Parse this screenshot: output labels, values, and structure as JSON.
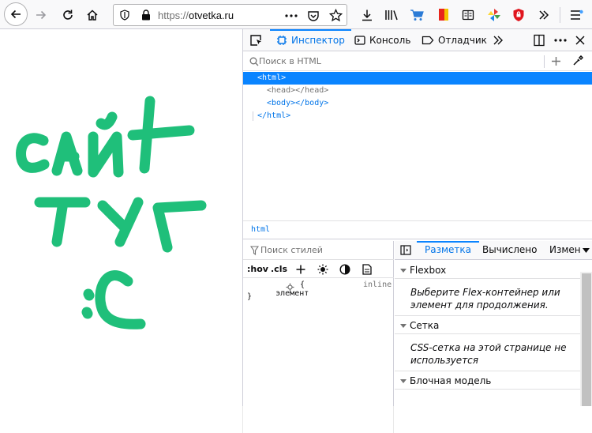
{
  "toolbar": {
    "url_protocol": "https://",
    "url_host": "otvetka.ru"
  },
  "devtools": {
    "tabs": [
      {
        "label": "Инспектор"
      },
      {
        "label": "Консоль"
      },
      {
        "label": "Отладчик"
      }
    ],
    "search_placeholder": "Поиск в HTML",
    "markup": [
      "<html>",
      "<head></head>",
      "<body></body>",
      "</html>"
    ],
    "breadcrumb": "html",
    "rules": {
      "filter_placeholder": "Поиск стилей",
      "hov": ":hov",
      "cls": ".cls",
      "element_label": "элемент",
      "brace_open": "{",
      "brace_close": "}",
      "inline_label": "inline"
    },
    "layout": {
      "tabs": [
        "Разметка",
        "Вычислено",
        "Измене"
      ],
      "sections": [
        {
          "title": "Flexbox",
          "body": "Выберите Flex-контейнер или элемент для продолжения."
        },
        {
          "title": "Сетка",
          "body": "CSS-сетка на этой странице не используется"
        },
        {
          "title": "Блочная модель",
          "body": ""
        }
      ]
    }
  },
  "page_content": {
    "handwriting_lines": [
      "САЙТ",
      "ТУТ",
      ":С"
    ],
    "ink_color": "#1fbf7a"
  }
}
